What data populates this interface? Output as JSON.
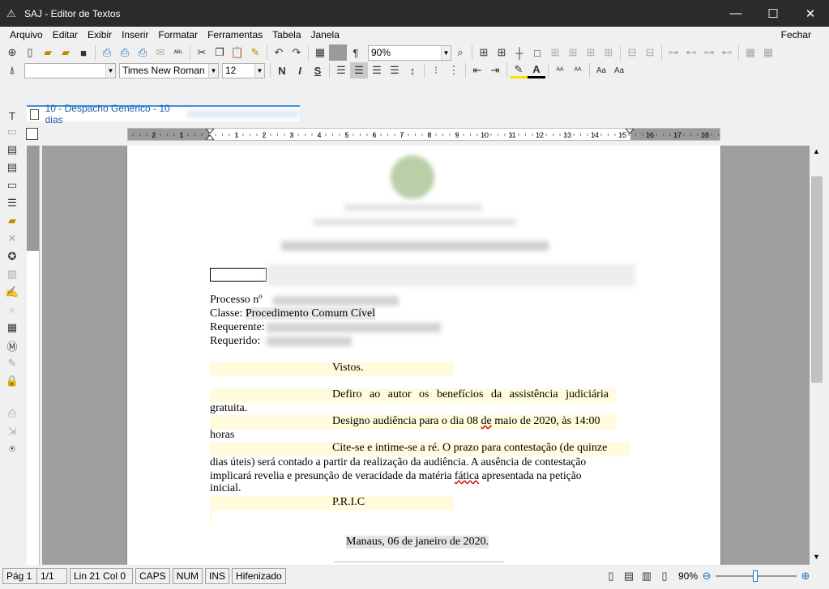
{
  "window": {
    "title": "SAJ - Editor de Textos"
  },
  "menu": [
    "Arquivo",
    "Editar",
    "Exibir",
    "Inserir",
    "Formatar",
    "Ferramentas",
    "Tabela",
    "Janela"
  ],
  "menu_close": "Fechar",
  "toolbar": {
    "zoom_value": "90%",
    "style_value": "",
    "font_value": "Times New Roman",
    "size_value": "12",
    "bold": "N",
    "italic": "I",
    "strike": "S"
  },
  "tab": {
    "label": "10 - Despacho Genérico - 10 dias"
  },
  "ruler": {
    "labels": [
      "2",
      "1",
      "1",
      "2",
      "3",
      "4",
      "5",
      "6",
      "7",
      "8",
      "9",
      "10",
      "11",
      "12",
      "13",
      "14",
      "15",
      "16",
      "17",
      "18"
    ]
  },
  "document": {
    "processo": "Processo nº",
    "classe_label": "Classe:",
    "classe_value": "Procedimento Comum Cível",
    "requerente": "Requerente:",
    "requerido": "Requerido:",
    "vistos": "Vistos.",
    "p1a": "Defiro ao autor os benefícios da assistência judiciária",
    "p1b": "gratuita.",
    "p2a_pre": "Designo audiência para o dia 08 ",
    "p2a_de": "de",
    "p2a_post": " maio de 2020, às 14:00",
    "p2b": "horas",
    "p3a": "Cite-se e intime-se a ré. O prazo para contestação (de quinze",
    "p3b": "dias úteis) será contado a partir da realização da audiência. A ausência de contestação",
    "p3c_pre": "implicará revelia e presunção de veracidade da matéria ",
    "p3c_fatica": "fática",
    "p3c_post": " apresentada na petição",
    "p3d": "inicial.",
    "pric": "P.R.I.C",
    "date": "Manaus, 06 de janeiro de 2020."
  },
  "status": {
    "page": "Pág 1",
    "pages": "1/1",
    "line_col": "Lin 21  Col 0",
    "caps": "CAPS",
    "num": "NUM",
    "ins": "INS",
    "hifen": "Hifenizado",
    "zoom": "90%"
  }
}
